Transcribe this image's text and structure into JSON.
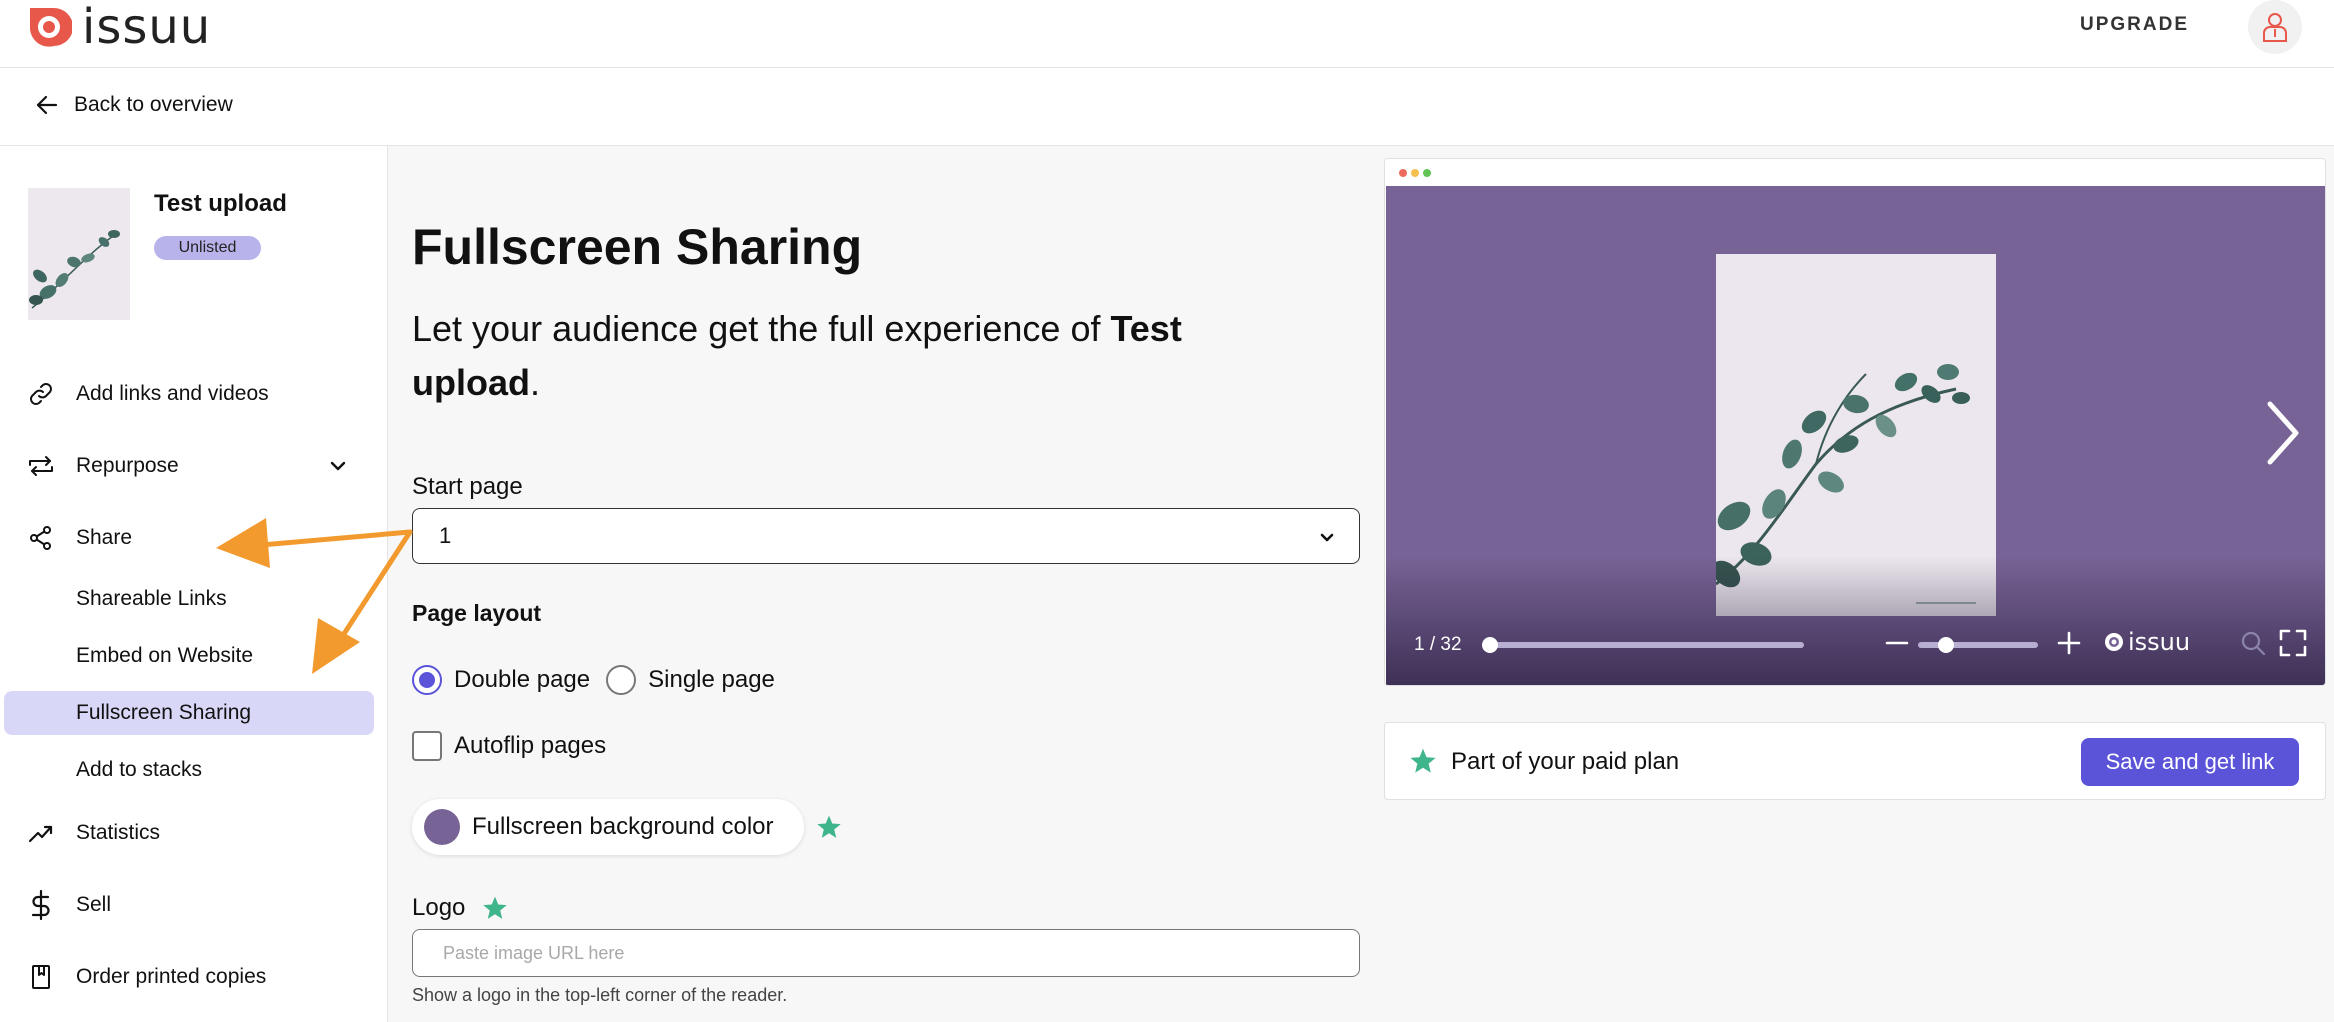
{
  "brand": {
    "name": "issuu"
  },
  "header": {
    "upgrade_label": "UPGRADE"
  },
  "back": {
    "label": "Back to overview"
  },
  "document": {
    "title": "Test upload",
    "status": "Unlisted"
  },
  "sidebar": {
    "items": [
      {
        "label": "Add links and videos",
        "icon": "link-icon"
      },
      {
        "label": "Repurpose",
        "icon": "repurpose-icon"
      },
      {
        "label": "Share",
        "icon": "share-icon"
      },
      {
        "label": "Statistics",
        "icon": "trending-up-icon"
      },
      {
        "label": "Sell",
        "icon": "dollar-icon"
      },
      {
        "label": "Order printed copies",
        "icon": "book-icon"
      }
    ],
    "share_subitems": [
      {
        "label": "Shareable Links",
        "active": false
      },
      {
        "label": "Embed on Website",
        "active": false
      },
      {
        "label": "Fullscreen Sharing",
        "active": true
      },
      {
        "label": "Add to stacks",
        "active": false
      }
    ]
  },
  "main": {
    "title": "Fullscreen Sharing",
    "lead_prefix": "Let your audience get the full experience of ",
    "lead_doc": "Test upload",
    "lead_suffix": ".",
    "start_page_label": "Start page",
    "start_page_value": "1",
    "page_layout_label": "Page layout",
    "layout_options": [
      {
        "label": "Double page",
        "checked": true
      },
      {
        "label": "Single page",
        "checked": false
      }
    ],
    "autoflip_label": "Autoflip pages",
    "autoflip_checked": false,
    "bg_color_label": "Fullscreen background color",
    "bg_color": "#786396",
    "logo_label": "Logo",
    "logo_placeholder": "Paste image URL here",
    "logo_hint": "Show a logo in the top-left corner of the reader."
  },
  "preview": {
    "page_counter": "1 / 32",
    "brand": "issuu",
    "progress": 0,
    "zoom_level": 0.2
  },
  "plan": {
    "text": "Part of your paid plan",
    "button_label": "Save and get link"
  },
  "colors": {
    "accent": "#5b54d9",
    "badge": "#b9b3ec",
    "active_nav": "#d9d7f7",
    "premium_star": "#3fb58c",
    "brand_red": "#e8584a",
    "annotation": "#f29a2e"
  }
}
